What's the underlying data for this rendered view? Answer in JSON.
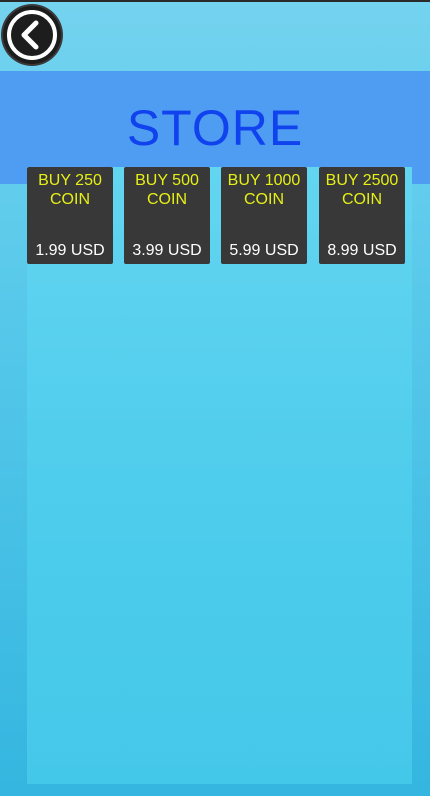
{
  "store": {
    "title": "STORE",
    "products": [
      {
        "title_line1": "BUY 250",
        "title_line2": "COIN",
        "price": "1.99 USD"
      },
      {
        "title_line1": "BUY 500",
        "title_line2": "COIN",
        "price": "3.99 USD"
      },
      {
        "title_line1": "BUY 1000",
        "title_line2": "COIN",
        "price": "5.99 USD"
      },
      {
        "title_line1": "BUY 2500",
        "title_line2": "COIN",
        "price": "8.99 USD"
      }
    ]
  },
  "icons": {
    "back": "back-arrow-icon"
  },
  "colors": {
    "title": "#1043ee",
    "product_title": "#e6f014",
    "product_price": "#ffffff",
    "card_background": "#383838",
    "header_band": "#4f9df2"
  }
}
